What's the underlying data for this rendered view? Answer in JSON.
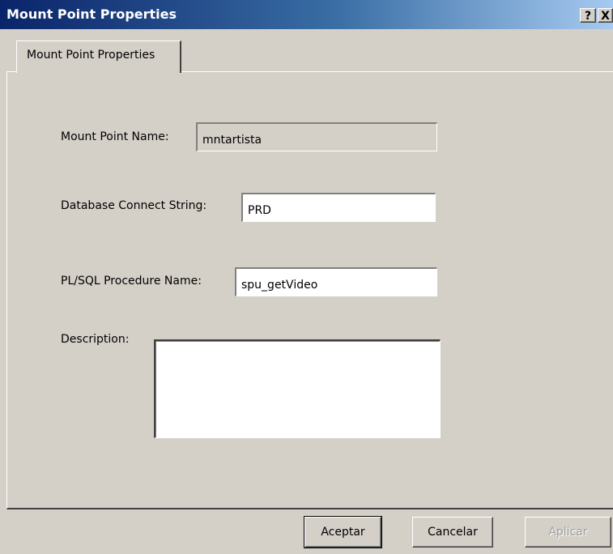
{
  "window": {
    "title": "Mount Point Properties",
    "help_label": "?",
    "close_label": "X"
  },
  "tabs": [
    {
      "label": "Mount Point Properties",
      "selected": true
    }
  ],
  "form": {
    "mount_point_name": {
      "label": "Mount Point Name:",
      "value": "mntartista",
      "readonly": true
    },
    "connect_string": {
      "label": "Database Connect String:",
      "value": "PRD"
    },
    "procedure_name": {
      "label": "PL/SQL Procedure Name:",
      "value": "spu_getVideo"
    },
    "description": {
      "label": "Description:",
      "value": ""
    }
  },
  "buttons": {
    "ok": "Aceptar",
    "cancel": "Cancelar",
    "apply": "Aplicar"
  },
  "colors": {
    "face": "#d4d0c8",
    "title_start": "#0a246a",
    "title_end": "#a6caf0"
  }
}
